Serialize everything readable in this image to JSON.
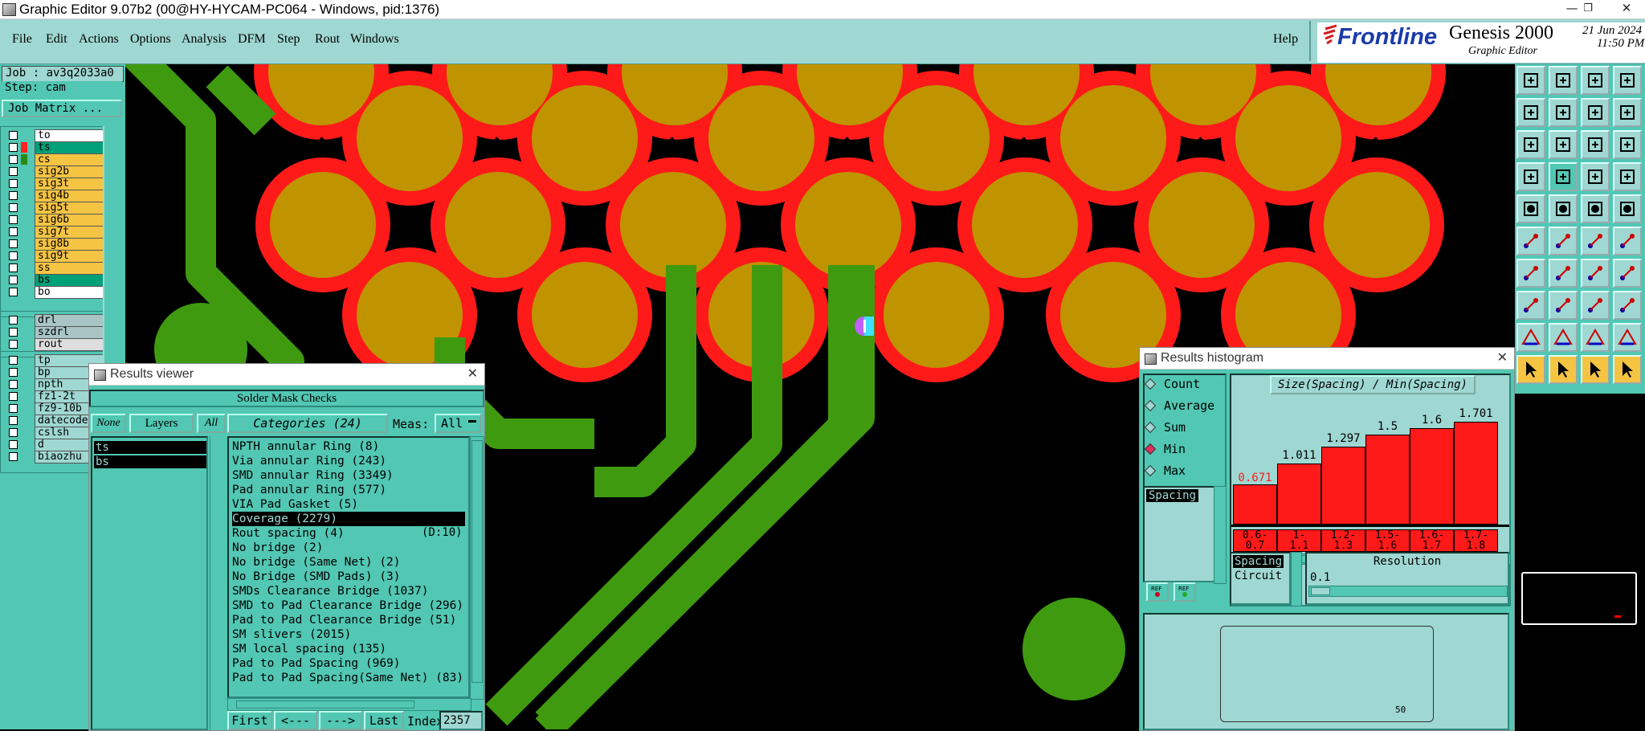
{
  "window": {
    "title": "Graphic Editor 9.07b2 (00@HY-HYCAM-PC064 - Windows, pid:1376)"
  },
  "menu": {
    "file": "File",
    "edit": "Edit",
    "actions": "Actions",
    "options": "Options",
    "analysis": "Analysis",
    "dfm": "DFM",
    "step": "Step",
    "rout": "Rout",
    "windows": "Windows",
    "help": "Help"
  },
  "brand": {
    "logo": "Frontline",
    "product": "Genesis 2000",
    "subtitle": "Graphic Editor",
    "date": "21 Jun 2024",
    "time": "11:50 PM"
  },
  "job": {
    "job_label": "Job : av3q2033a0",
    "step_label": "Step: cam",
    "matrix_button": "Job Matrix ..."
  },
  "layers_group1": [
    {
      "name": "to",
      "color": "#ffffff"
    },
    {
      "name": "ts",
      "color": "#00a078",
      "swatch": "#ff2020"
    },
    {
      "name": "cs",
      "color": "#f5c443",
      "swatch": "#2a8a10"
    },
    {
      "name": "sig2b",
      "color": "#f5c443"
    },
    {
      "name": "sig3t",
      "color": "#f5c443"
    },
    {
      "name": "sig4b",
      "color": "#f5c443"
    },
    {
      "name": "sig5t",
      "color": "#f5c443"
    },
    {
      "name": "sig6b",
      "color": "#f5c443"
    },
    {
      "name": "sig7t",
      "color": "#f5c443"
    },
    {
      "name": "sig8b",
      "color": "#f5c443"
    },
    {
      "name": "sig9t",
      "color": "#f5c443"
    },
    {
      "name": "ss",
      "color": "#f5c443"
    },
    {
      "name": "bs",
      "color": "#00a078"
    },
    {
      "name": "bo",
      "color": "#ffffff"
    }
  ],
  "layers_group2": [
    {
      "name": "drl",
      "color": "#a8c4c4"
    },
    {
      "name": "szdrl",
      "color": "#a8c4c4"
    },
    {
      "name": "rout",
      "color": "#dddddd"
    }
  ],
  "layers_group3": [
    {
      "name": "tp",
      "color": "#9fd7d2"
    },
    {
      "name": "bp",
      "color": "#9fd7d2"
    },
    {
      "name": "npth",
      "color": "#9fd7d2"
    },
    {
      "name": "fz1-2t",
      "color": "#9fd7d2"
    },
    {
      "name": "fz9-10b",
      "color": "#9fd7d2"
    },
    {
      "name": "datecode-",
      "color": "#9fd7d2"
    },
    {
      "name": "cslsh",
      "color": "#9fd7d2"
    },
    {
      "name": "d",
      "color": "#9fd7d2"
    },
    {
      "name": "biaozhu",
      "color": "#9fd7d2"
    }
  ],
  "results_viewer": {
    "title": "Results viewer",
    "heading": "Solder Mask Checks",
    "none": "None",
    "layers": "Layers",
    "all": "All",
    "categories_label": "Categories (24)",
    "meas_label": "Meas:",
    "meas_value": "All",
    "layer_list": [
      "ts",
      "bs"
    ],
    "categories": [
      "NPTH annular Ring (8)",
      "Via annular Ring (243)",
      "SMD annular Ring (3349)",
      "Pad annular Ring (577)",
      "VIA Pad Gasket (5)",
      "Coverage (2279)",
      "Rout spacing (4)",
      "No bridge (2)",
      "No bridge (Same Net) (2)",
      "No Bridge (SMD Pads) (3)",
      "SMDs Clearance Bridge (1037)",
      "SMD to Pad Clearance Bridge (296)",
      "Pad to Pad Clearance Bridge (51)",
      "SM slivers (2015)",
      "SM local spacing (135)",
      "Pad to Pad Spacing (969)",
      "Pad to Pad Spacing(Same Net) (83)"
    ],
    "rout_extra": "(D:10)",
    "selected_index": 5,
    "nav": {
      "first": "First",
      "prev": "<---",
      "next": "--->",
      "last": "Last",
      "index_label": "Index:",
      "index_value": "2357"
    }
  },
  "histogram": {
    "title": "Results histogram",
    "modes": [
      "Count",
      "Average",
      "Sum",
      "Min",
      "Max"
    ],
    "selected_mode": "Min",
    "measure_list": [
      "Spacing"
    ],
    "chart_title": "Size(Spacing) / Min(Spacing)",
    "bars": [
      {
        "label": "0.671",
        "range": [
          "0.6-",
          "0.7"
        ],
        "value": 0.671,
        "color": "#ff1a1a"
      },
      {
        "label": "1.011",
        "range": [
          "1-",
          "1.1"
        ],
        "value": 1.011
      },
      {
        "label": "1.297",
        "range": [
          "1.2-",
          "1.3"
        ],
        "value": 1.297
      },
      {
        "label": "1.5",
        "range": [
          "1.5-",
          "1.6"
        ],
        "value": 1.5
      },
      {
        "label": "1.6",
        "range": [
          "1.6-",
          "1.7"
        ],
        "value": 1.6
      },
      {
        "label": "1.701",
        "range": [
          "1.7-",
          "1.8"
        ],
        "value": 1.701
      }
    ],
    "group_list": [
      "Spacing",
      "Circuit"
    ],
    "resolution_label": "Resolution",
    "resolution_value": "0.1",
    "preview_label": "50"
  },
  "colors": {
    "panel": "#52c7b3",
    "panel_light": "#9fd7d2",
    "pad": "#bf9400",
    "mask": "#ff1a1a",
    "trace": "#3f9a10"
  }
}
